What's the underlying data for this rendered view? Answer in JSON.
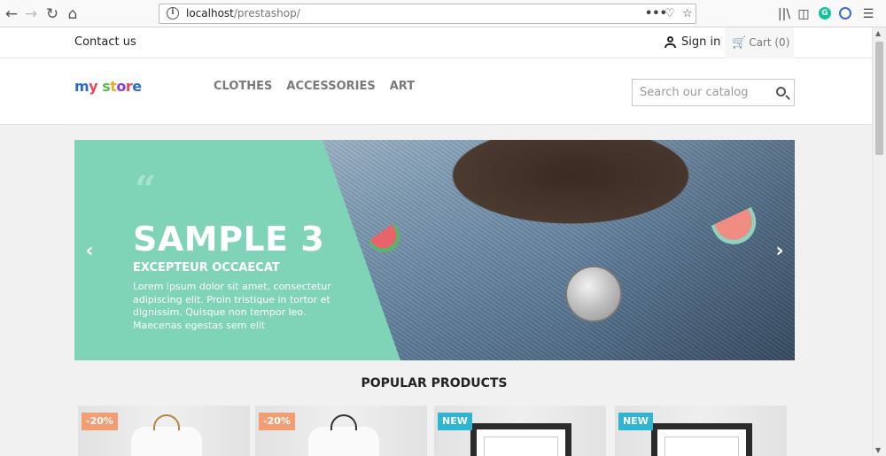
{
  "browser": {
    "url_host": "localhost",
    "url_path": "/prestashop/",
    "back_icon": "arrow-left-icon",
    "forward_icon": "arrow-right-icon",
    "reload_icon": "reload-icon",
    "home_icon": "home-icon",
    "page_actions_icon": "ellipsis-icon",
    "pocket_icon": "pocket-icon",
    "bookmark_icon": "star-icon",
    "library_icon": "library-icon",
    "sidebar_icon": "sidebar-icon",
    "menu_icon": "hamburger-icon"
  },
  "topnav": {
    "contact": "Contact us",
    "signin": "Sign in",
    "cart": "Cart (0)"
  },
  "header": {
    "logo": "my store",
    "menu": [
      "CLOTHES",
      "ACCESSORIES",
      "ART"
    ],
    "search_placeholder": "Search our catalog"
  },
  "hero": {
    "title": "SAMPLE 3",
    "subtitle": "EXCEPTEUR OCCAECAT",
    "text": "Lorem ipsum dolor sit amet, consectetur adipiscing elit. Proin tristique in tortor et dignissim. Quisque non tempor leo. Maecenas egestas sem elit"
  },
  "section": {
    "title": "POPULAR PRODUCTS"
  },
  "products": [
    {
      "badge": "-20%",
      "badge_type": "discount"
    },
    {
      "badge": "-20%",
      "badge_type": "discount"
    },
    {
      "badge": "NEW",
      "badge_type": "new"
    },
    {
      "badge": "NEW",
      "badge_type": "new"
    }
  ],
  "colors": {
    "accent": "#2fb5d2",
    "hero_panel": "#7fd4b7",
    "discount": "#f39d72"
  }
}
